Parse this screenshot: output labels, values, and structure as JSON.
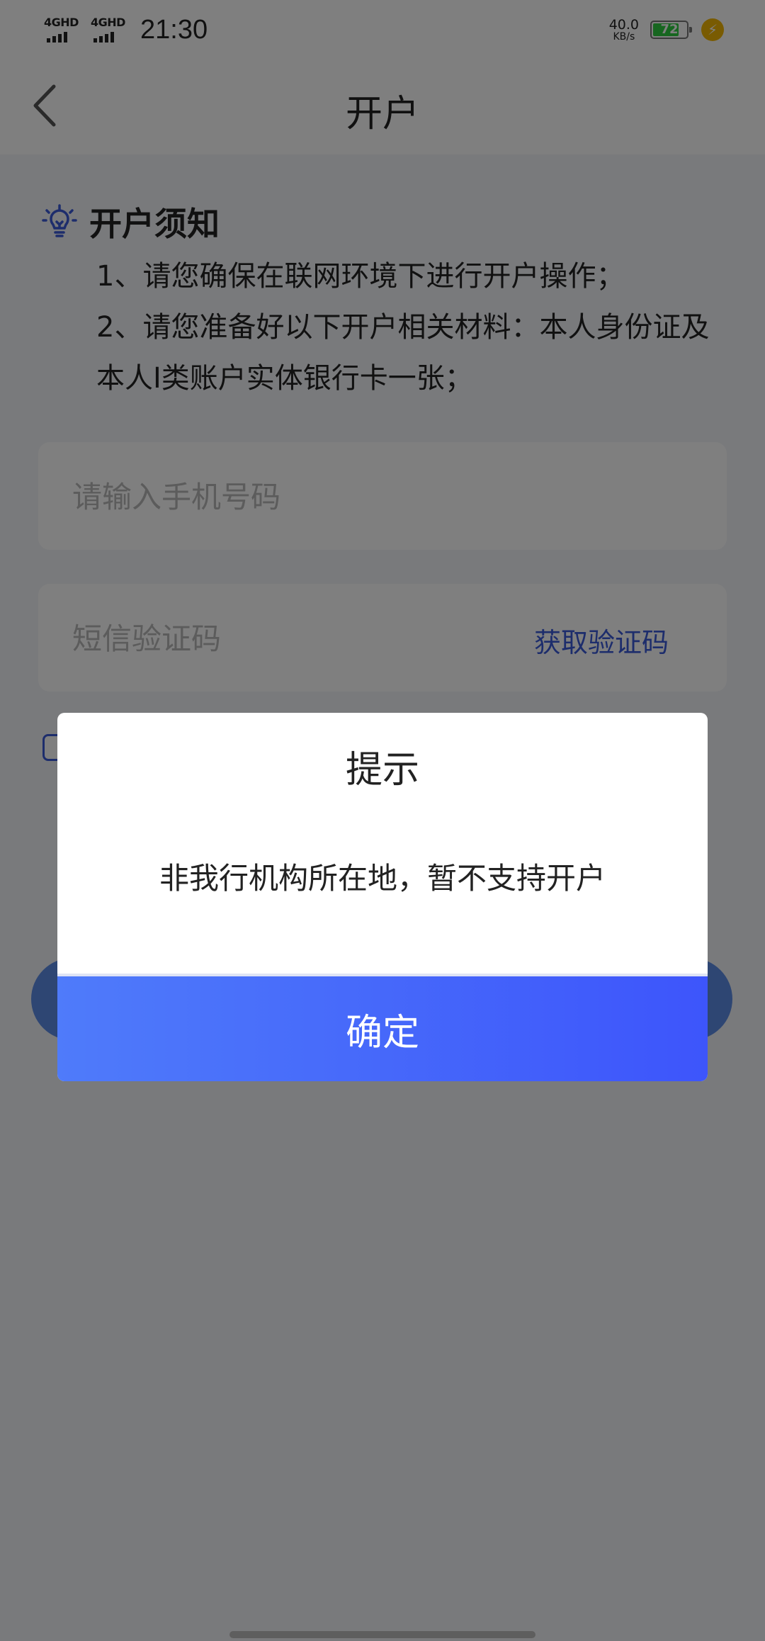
{
  "status_bar": {
    "network1": "4GHD",
    "network2": "4GHD",
    "time": "21:30",
    "speed_value": "40.0",
    "speed_unit": "KB/s",
    "battery": "72"
  },
  "nav": {
    "title": "开户"
  },
  "notice": {
    "title": "开户须知",
    "line1": "1、请您确保在联网环境下进行开户操作；",
    "line2": "2、请您准备好以下开户相关材料：本人身份证及本人I类账户实体银行卡一张；"
  },
  "form": {
    "phone_placeholder": "请输入手机号码",
    "sms_placeholder": "短信验证码",
    "get_code_label": "获取验证码"
  },
  "dialog": {
    "title": "提示",
    "message": "非我行机构所在地，暂不支持开户",
    "confirm_label": "确定"
  },
  "colors": {
    "accent": "#3a5ad9",
    "confirm_gradient_start": "#4f7bfa",
    "confirm_gradient_end": "#3d55fb",
    "battery": "#2ecc40"
  }
}
